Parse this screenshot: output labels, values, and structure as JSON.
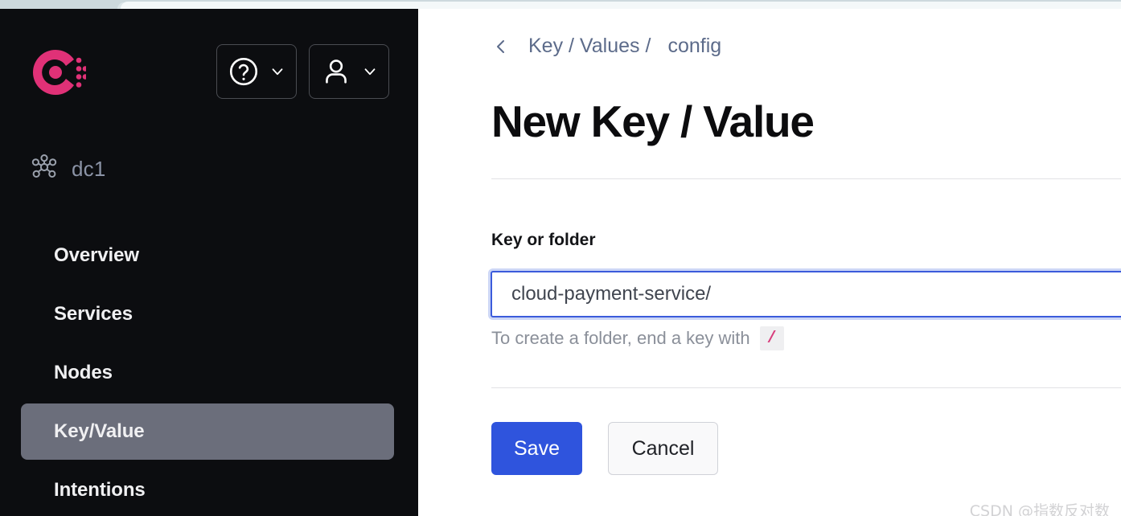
{
  "browser": {
    "tab_strip_color": "#cdd9dd",
    "active_tab_color": "#f4f8f9"
  },
  "sidebar": {
    "background_color": "#0c0d10",
    "logo": {
      "name": "consul-logo",
      "brand_color": "#e03177"
    },
    "header_buttons": [
      {
        "name": "help-menu",
        "icon": "question-circle-icon",
        "chevron": "chevron-down-icon"
      },
      {
        "name": "user-menu",
        "icon": "user-icon",
        "chevron": "chevron-down-icon"
      }
    ],
    "datacenter": {
      "icon": "network-nodes-icon",
      "label": "dc1",
      "label_color": "#8b93a6"
    },
    "nav_active_color": "#6b6e7b",
    "items": [
      {
        "label": "Overview",
        "active": false
      },
      {
        "label": "Services",
        "active": false
      },
      {
        "label": "Nodes",
        "active": false
      },
      {
        "label": "Key/Value",
        "active": true
      },
      {
        "label": "Intentions",
        "active": false
      }
    ]
  },
  "main": {
    "breadcrumb": {
      "back_icon": "chevron-left-icon",
      "root": "Key / Values",
      "separator": "/",
      "current": "config",
      "color": "#5c6b8a"
    },
    "page_title": "New Key / Value",
    "form": {
      "field_label": "Key or folder",
      "input_value": "cloud-payment-service/",
      "input_placeholder": "Key or folder",
      "input_focused": true,
      "focus_border_color": "#3b5bdb",
      "help_prefix": "To create a folder, end a key with",
      "help_code": "/",
      "help_code_color": "#d83d7c"
    },
    "actions": {
      "save_label": "Save",
      "save_color": "#2f54dd",
      "cancel_label": "Cancel"
    }
  },
  "watermark": {
    "text": "CSDN @指数反对数"
  }
}
